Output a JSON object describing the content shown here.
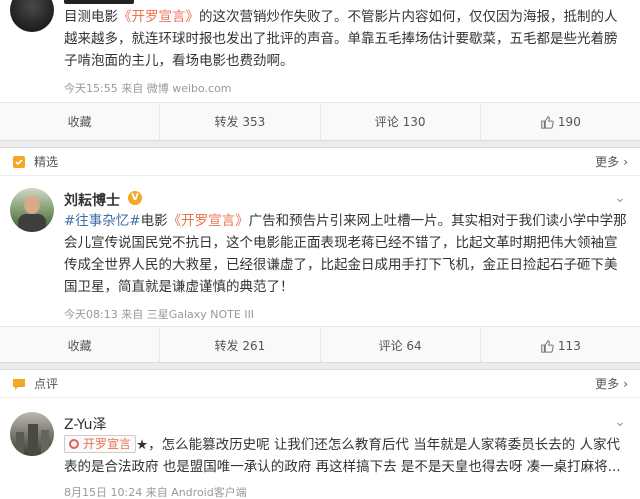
{
  "post1": {
    "text_a": "目测电影",
    "link": "《开罗宣言》",
    "text_b": "的这次营销炒作失败了。不管影片内容如何，仅仅因为海报，抵制的人越来越多，就连环球时报也发出了批评的声音。单靠五毛捧场估计要歇菜，五毛都是些光着膀子啃泡面的主儿，看场电影也费劲啊。",
    "meta": "今天15:55 来自 微博 weibo.com",
    "actions": {
      "save": "收藏",
      "repost": "转发 353",
      "comment": "评论 130",
      "like": "190"
    }
  },
  "section2": {
    "title": "精选",
    "more": "更多"
  },
  "post2": {
    "name": "刘耘博士",
    "hashtag": "#往事杂忆#",
    "text_a": "电影",
    "link": "《开罗宣言》",
    "text_b": "广告和预告片引来网上吐槽一片。其实相对于我们读小学中学那会儿宣传说国民党不抗日，这个电影能正面表现老蒋已经不错了，比起文革时期把伟大领袖宣传成全世界人民的大救星，已经很谦虚了，比起金日成用手打下飞机，金正日捡起石子砸下美国卫星，简直就是谦虚谨慎的典范了！",
    "meta": "今天08:13 来自 三星Galaxy NOTE III",
    "actions": {
      "save": "收藏",
      "repost": "转发 261",
      "comment": "评论 64",
      "like": "113"
    }
  },
  "section3": {
    "title": "点评",
    "more": "更多"
  },
  "post3": {
    "name": "Z-Yu泽",
    "chip": "开罗宣言",
    "text_a": "★，怎么能篡改历史呢 让我们还怎么教育后代 当年就是人家蒋委员长去的 人家代表的是合法政府 也是盟国唯一承认的政府 再这样搞下去 是不是天皇也得去呀 凑一桌打麻将...",
    "meta": "8月15日 10:24 来自 Android客户端"
  },
  "colors": {
    "link": "#eb7350",
    "hashtag": "#3f6ea8",
    "vip": "#f5a623"
  },
  "icons": [
    "like-icon",
    "featured-icon",
    "comment-review-icon",
    "chevron-down-icon",
    "chevron-right-icon",
    "vip-badge-icon"
  ]
}
